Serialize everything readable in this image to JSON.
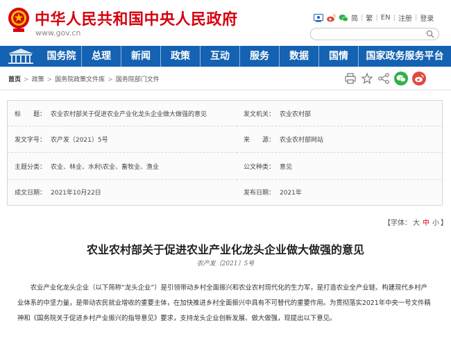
{
  "header": {
    "site_title": "中华人民共和国中央人民政府",
    "site_url": "www.gov.cn",
    "links": [
      "简",
      "繁",
      "EN",
      "注册",
      "登录"
    ],
    "search": {
      "value": "",
      "placeholder": ""
    }
  },
  "nav": {
    "items": [
      "国务院",
      "总理",
      "新闻",
      "政策",
      "互动",
      "服务",
      "数据",
      "国情",
      "国家政务服务平台"
    ]
  },
  "breadcrumb": {
    "items": [
      "首页",
      "政策",
      "国务院政策文件库",
      "国务院部门文件"
    ]
  },
  "info": {
    "rows": [
      [
        {
          "label": "标　　题：",
          "value": "农业农村部关于促进农业产业化龙头企业做大做强的意见"
        },
        {
          "label": "发文机关：",
          "value": "农业农村部"
        }
      ],
      [
        {
          "label": "发文字号：",
          "value": "农产发〔2021〕5号"
        },
        {
          "label": "来　　源：",
          "value": "农业农村部网站"
        }
      ],
      [
        {
          "label": "主题分类：",
          "value": "农业、林业、水利\\农业、畜牧业、渔业"
        },
        {
          "label": "公文种类：",
          "value": "意见"
        }
      ],
      [
        {
          "label": "成文日期：",
          "value": "2021年10月22日"
        },
        {
          "label": "发布日期：",
          "value": "2021年"
        }
      ]
    ]
  },
  "font_size": {
    "prefix": "【字体：",
    "options": [
      "大",
      "中",
      "小"
    ],
    "suffix": "】",
    "active": "中"
  },
  "article": {
    "title": "农业农村部关于促进农业产业化龙头企业做大做强的意见",
    "doc_no": "农产发〔2021〕5号",
    "body": "农业产业化龙头企业（以下简称“龙头企业”）是引领带动乡村全面振兴和农业农村现代化的生力军，是打造农业全产业链、构建现代乡村产业体系的中坚力量，是带动农民就业增收的重要主体，在加快推进乡村全面振兴中具有不可替代的重要作用。为贯彻落实2021年中央一号文件精神和《国务院关于促进乡村产业振兴的指导意见》要求，支持龙头企业创新发展、做大做强，现提出以下意见。"
  },
  "colors": {
    "brand_red": "#d7000f",
    "nav_blue": "#1462b1",
    "wechat_green": "#2fb24a",
    "weibo_red": "#e2483d"
  },
  "icons": [
    "national-emblem-icon",
    "accessibility-icon",
    "weibo-icon",
    "wechat-icon",
    "search-icon",
    "building-icon",
    "print-icon",
    "favorite-icon",
    "share-icon"
  ]
}
